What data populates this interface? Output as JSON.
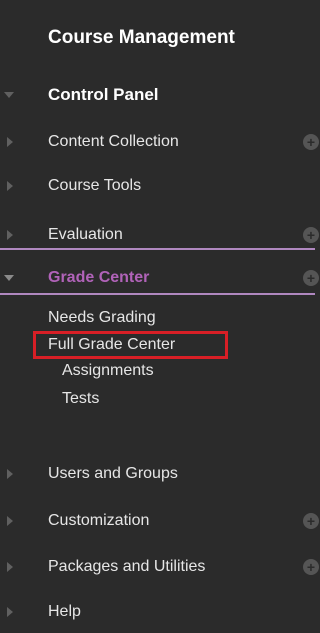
{
  "panel": {
    "title": "Course Management",
    "control_panel": "Control Panel",
    "items": {
      "content_collection": "Content Collection",
      "course_tools": "Course Tools",
      "evaluation": "Evaluation",
      "grade_center": "Grade Center",
      "users_and_groups": "Users and Groups",
      "customization": "Customization",
      "packages_and_utilities": "Packages and Utilities",
      "help": "Help"
    },
    "grade_center_children": {
      "needs_grading": "Needs Grading",
      "full_grade_center": "Full Grade Center",
      "assignments": "Assignments",
      "tests": "Tests"
    },
    "plus_glyph": "+"
  },
  "colors": {
    "background": "#2b2b2b",
    "active_item": "#b163b9",
    "divider": "#b088c0",
    "highlight_box": "#d81f26"
  },
  "icons": {
    "expanded": "triangle-down-icon",
    "collapsed": "triangle-right-icon",
    "add": "plus-circle-icon"
  }
}
